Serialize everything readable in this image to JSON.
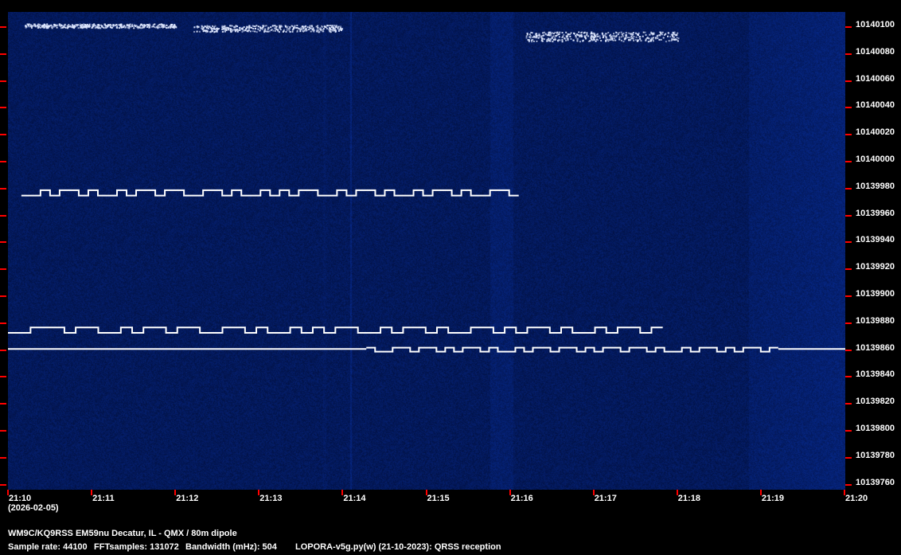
{
  "chart_data": {
    "type": "heatmap",
    "title": "QRSS spectrogram",
    "x_unit": "minutes after 21:10",
    "xlim": [
      0,
      10
    ],
    "ylim": [
      10139750,
      10140110
    ],
    "x_ticks": [
      "21:10",
      "21:11",
      "21:12",
      "21:13",
      "21:14",
      "21:15",
      "21:16",
      "21:17",
      "21:18",
      "21:19",
      "21:20"
    ],
    "y_ticks": [
      "10140100",
      "10140080",
      "10140060",
      "10140040",
      "10140020",
      "10140000",
      "10139980",
      "10139960",
      "10139940",
      "10139920",
      "10139900",
      "10139880",
      "10139860",
      "10139840",
      "10139820",
      "10139800",
      "10139780",
      "10139760"
    ],
    "date_label": "(2026-02-05)",
    "traces": [
      {
        "name": "fsk-trace-1",
        "t_start": 0.16,
        "t_end": 6.1,
        "f_low": 10139973,
        "f_high": 10139977,
        "bits": "0010110100101101100110100101011001011010010110100110"
      },
      {
        "name": "fsk-trace-2",
        "t_start": 0.0,
        "t_end": 7.82,
        "f_low": 10139871,
        "f_high": 10139875,
        "bits": "0011101100101101100110100101011001011010011010110100101101"
      },
      {
        "name": "carrier-flat",
        "t_start": 0.0,
        "t_end": 4.28,
        "f_low": 10139859,
        "f_high": 10139859,
        "bits": "0"
      },
      {
        "name": "fsk-trace-3",
        "t_start": 4.28,
        "t_end": 9.2,
        "f_low": 10139857,
        "f_high": 10139860,
        "bits": "10011011010110100101101101011011010010110101101"
      },
      {
        "name": "carrier-end",
        "t_start": 9.2,
        "t_end": 10.0,
        "f_low": 10139859,
        "f_high": 10139859,
        "bits": "0"
      }
    ],
    "blobs": [
      {
        "t_start": 6.15,
        "t_end": 8.0,
        "f_low": 10140088,
        "f_high": 10140095
      },
      {
        "t_start": 0.2,
        "t_end": 2.0,
        "f_low": 10140098,
        "f_high": 10140101
      },
      {
        "t_start": 2.2,
        "t_end": 4.0,
        "f_low": 10140095,
        "f_high": 10140100
      }
    ]
  },
  "footer": {
    "station": "WM9C/KQ9RSS EM59nu Decatur, IL - QMX / 80m dipole",
    "sample_rate": "Sample rate: 44100",
    "fft": "FFTsamples: 131072",
    "bandwidth": "Bandwidth (mHz): 504",
    "software": "LOPORA-v5g.py(w) (21-10-2023): QRSS reception"
  },
  "colors": {
    "background": "#0b1f55",
    "signal": "#ffffff",
    "tick": "#ff0000"
  }
}
